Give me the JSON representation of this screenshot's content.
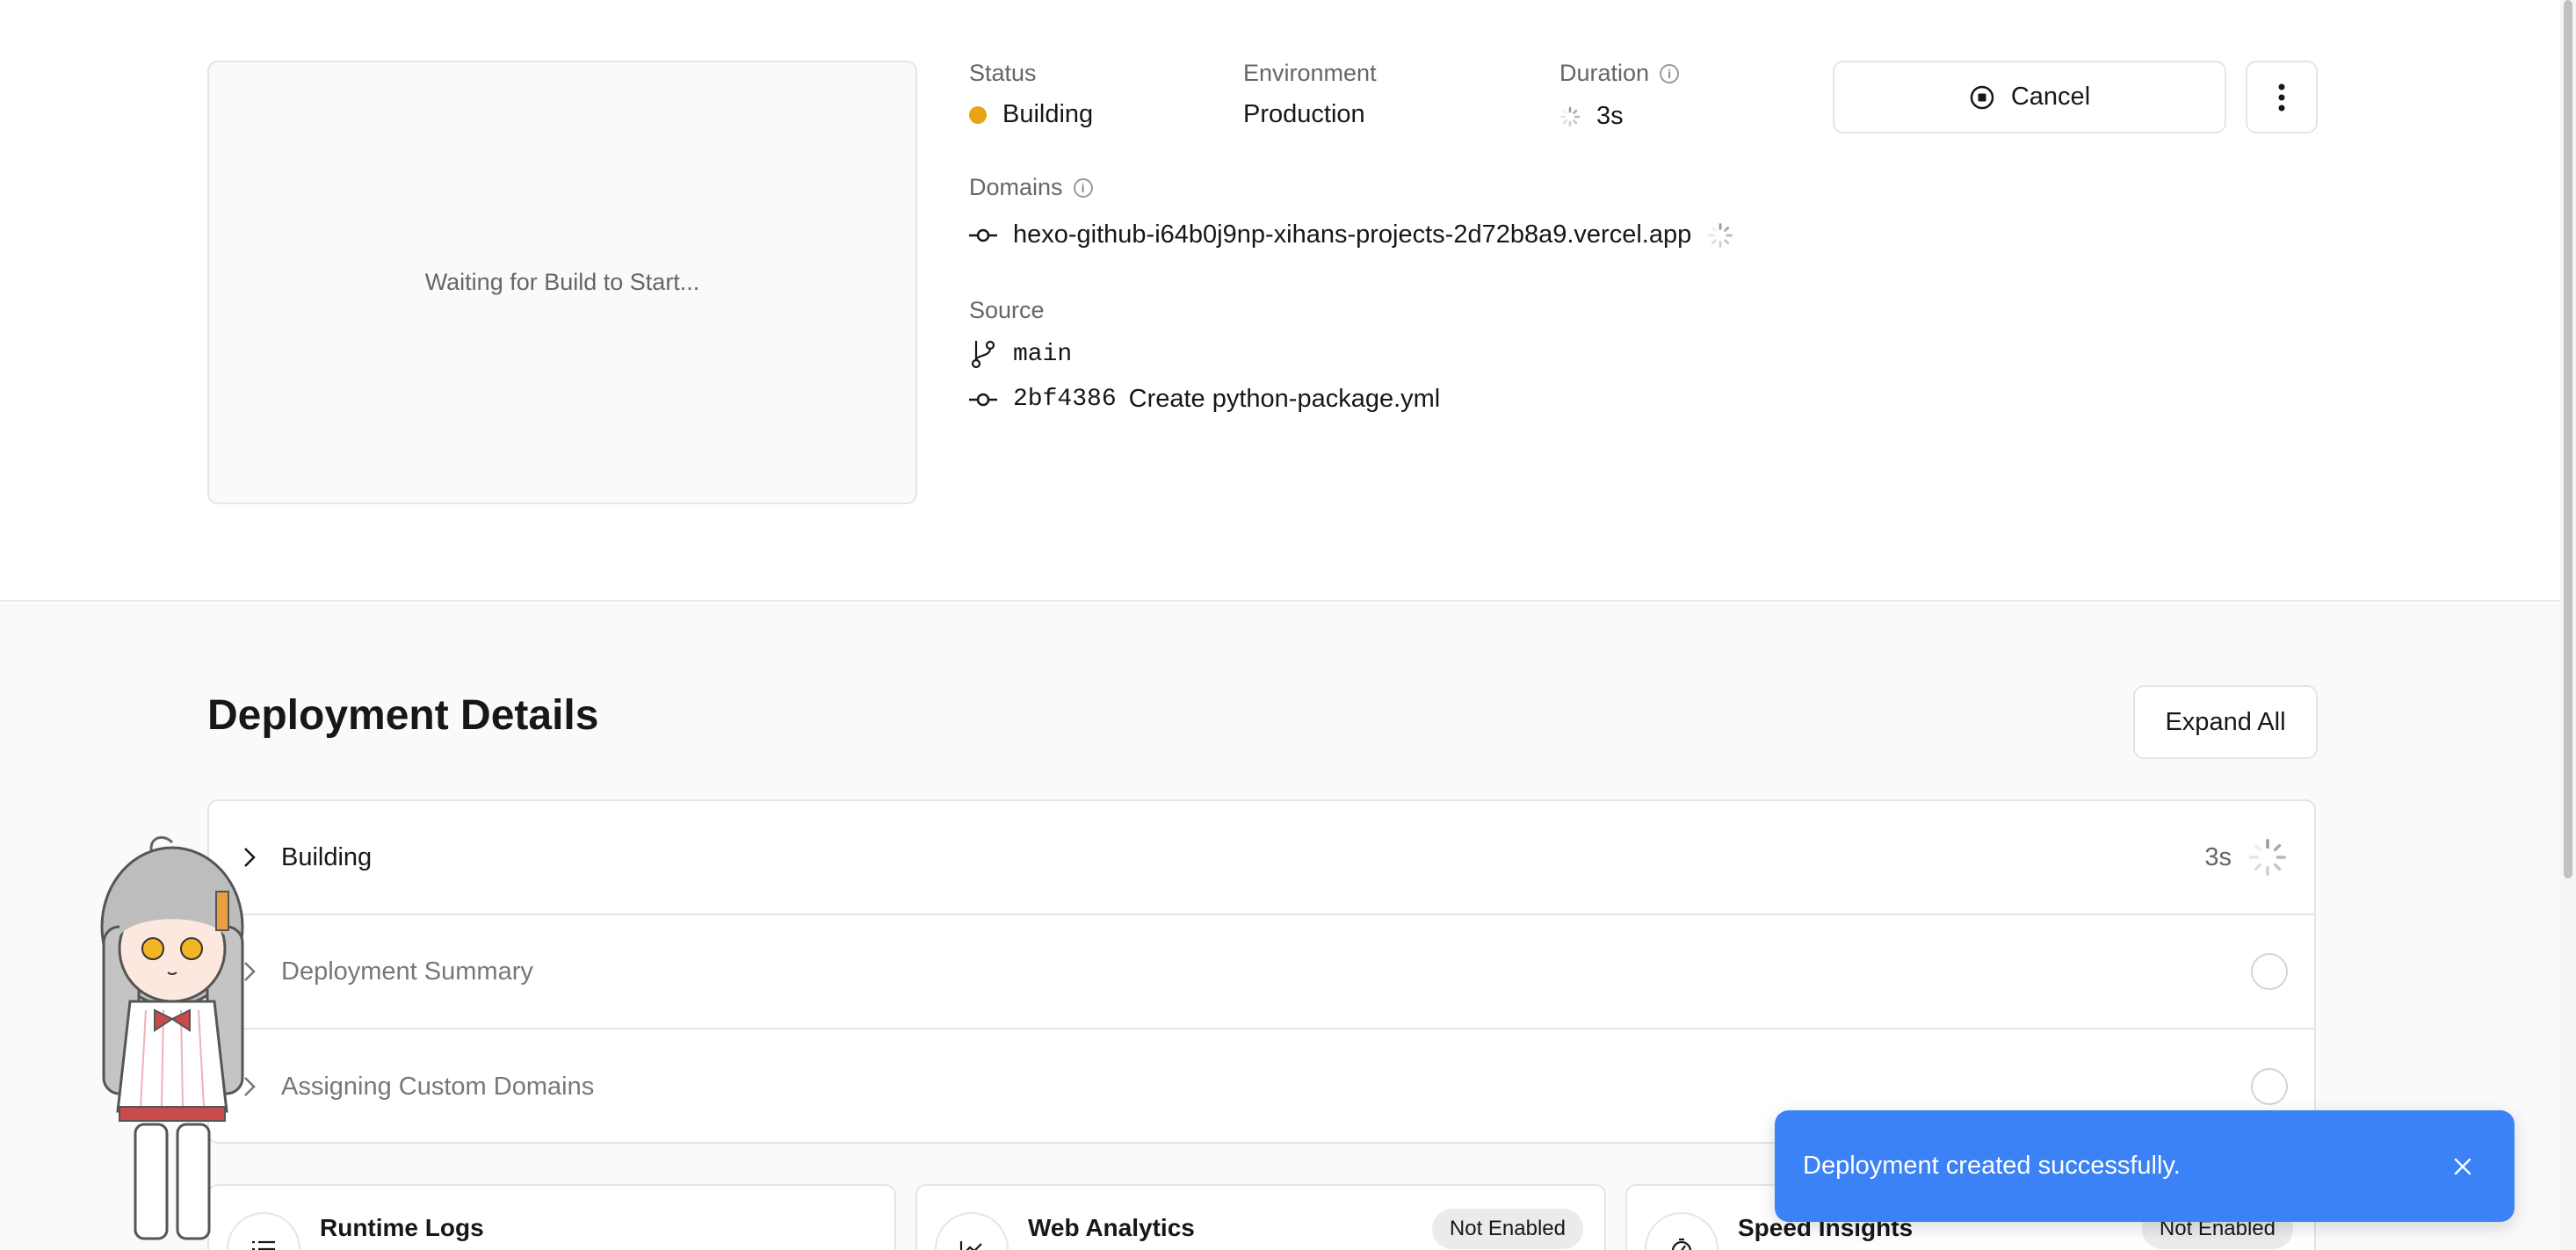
{
  "preview": {
    "text": "Waiting for Build to Start..."
  },
  "status": {
    "label": "Status",
    "value": "Building",
    "color": "#e7a415"
  },
  "environment": {
    "label": "Environment",
    "value": "Production"
  },
  "duration": {
    "label": "Duration",
    "value": "3s"
  },
  "actions": {
    "cancel_label": "Cancel",
    "more_icon": "more-vertical-icon"
  },
  "domains": {
    "label": "Domains",
    "url": "hexo-github-i64b0j9np-xihans-projects-2d72b8a9.vercel.app"
  },
  "source": {
    "label": "Source",
    "branch": "main",
    "commit_hash": "2bf4386",
    "commit_message": "Create python-package.yml"
  },
  "details": {
    "title": "Deployment Details",
    "expand_label": "Expand All",
    "rows": [
      {
        "label": "Building",
        "time": "3s",
        "state": "in-progress"
      },
      {
        "label": "Deployment Summary",
        "state": "pending"
      },
      {
        "label": "Assigning Custom Domains",
        "state": "pending"
      }
    ]
  },
  "cards": [
    {
      "title": "Runtime Logs",
      "icon": "list-icon"
    },
    {
      "title": "Web Analytics",
      "badge": "Not Enabled",
      "icon": "chart-icon"
    },
    {
      "title": "Speed Insights",
      "badge": "Not Enabled",
      "icon": "gauge-icon"
    }
  ],
  "toast": {
    "message": "Deployment created successfully.",
    "accent": "#3b82f6"
  }
}
